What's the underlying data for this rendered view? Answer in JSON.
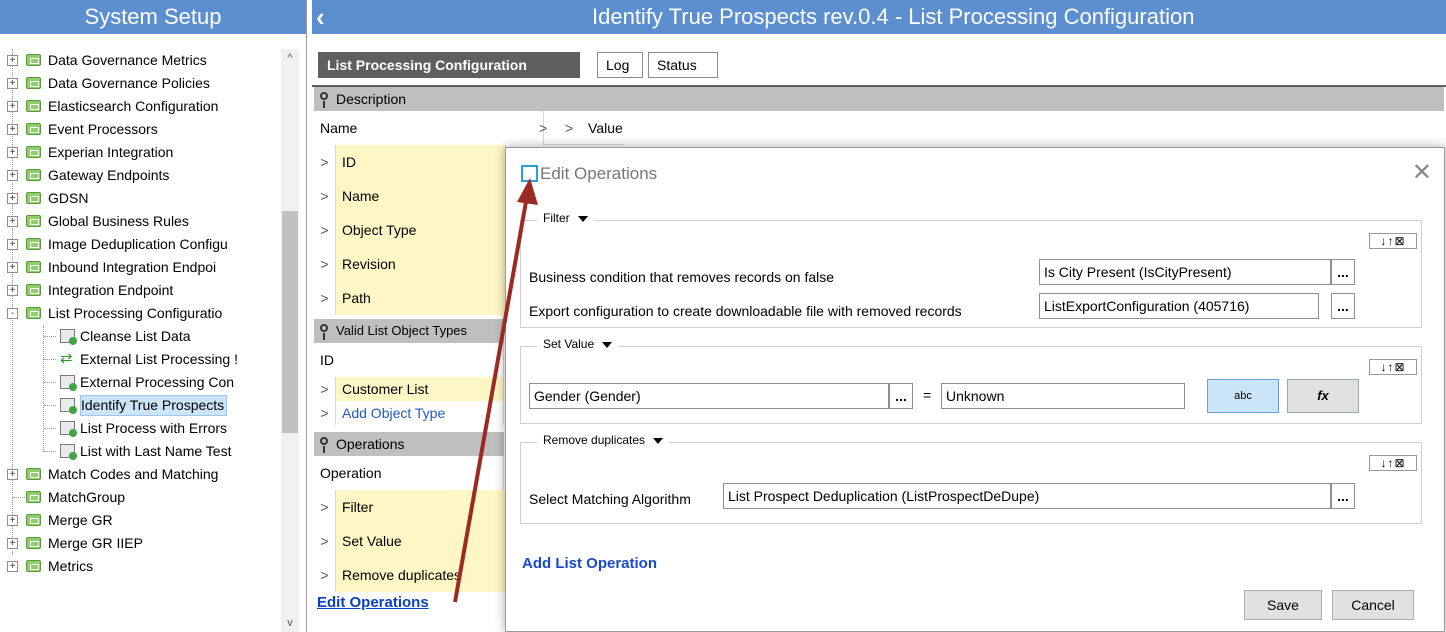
{
  "left_panel": {
    "title": "System Setup",
    "items": [
      {
        "label": "Data Governance Metrics"
      },
      {
        "label": "Data Governance Policies"
      },
      {
        "label": "Elasticsearch Configuration"
      },
      {
        "label": "Event Processors"
      },
      {
        "label": "Experian Integration"
      },
      {
        "label": "Gateway Endpoints"
      },
      {
        "label": "GDSN"
      },
      {
        "label": "Global Business Rules"
      },
      {
        "label": "Image Deduplication Configu"
      },
      {
        "label": "Inbound Integration Endpoi"
      },
      {
        "label": "Integration Endpoint"
      },
      {
        "label": "List Processing Configuratio"
      },
      {
        "label": "Cleanse List Data"
      },
      {
        "label": "External List Processing !"
      },
      {
        "label": "External Processing Con"
      },
      {
        "label": "Identify True Prospects"
      },
      {
        "label": "List Process with Errors"
      },
      {
        "label": "List with Last Name Test"
      },
      {
        "label": "Match Codes and Matching"
      },
      {
        "label": "MatchGroup"
      },
      {
        "label": "Merge GR"
      },
      {
        "label": "Merge GR IIEP"
      },
      {
        "label": "Metrics"
      }
    ]
  },
  "header": {
    "back_icon": "chevron-left-icon",
    "title": "Identify True Prospects rev.0.4 - List Processing Configuration"
  },
  "tabs": [
    {
      "label": "List Processing Configuration"
    },
    {
      "label": "Log"
    },
    {
      "label": "Status"
    }
  ],
  "description": {
    "section_label": "Description",
    "name_header": "Name",
    "value_header": "Value",
    "rows": [
      "ID",
      "Name",
      "Object Type",
      "Revision",
      "Path"
    ]
  },
  "valid_types": {
    "section_label": "Valid List Object Types",
    "id_header": "ID",
    "rows": [
      "Customer List"
    ],
    "add_link": "Add Object Type"
  },
  "operations": {
    "section_label": "Operations",
    "header": "Operation",
    "rows": [
      "Filter",
      "Set Value",
      "Remove duplicates"
    ],
    "edit_link": "Edit Operations"
  },
  "dialog": {
    "title": "Edit Operations",
    "close_icon": "close-icon",
    "move_controls": "↓↑⊠",
    "filter": {
      "title": "Filter",
      "condition_label": "Business condition that removes records on false",
      "condition_value": "Is City Present (IsCityPresent)",
      "export_label": "Export configuration to create downloadable file with removed records",
      "export_value": "ListExportConfiguration (405716)"
    },
    "set_value": {
      "title": "Set Value",
      "attribute_value": "Gender (Gender)",
      "equals": "=",
      "value": "Unknown",
      "text_button": "abc",
      "formula_button": "fx"
    },
    "remove_duplicates": {
      "title": "Remove duplicates",
      "label": "Select Matching Algorithm",
      "value": "List Prospect Deduplication (ListProspectDeDupe)"
    },
    "add_op": "Add List Operation",
    "save": "Save",
    "cancel": "Cancel",
    "dots": "..."
  },
  "colors": {
    "header_blue": "#5b8fd0",
    "yellow_cell": "#fff6c6",
    "arrow": "#9b2a22"
  }
}
